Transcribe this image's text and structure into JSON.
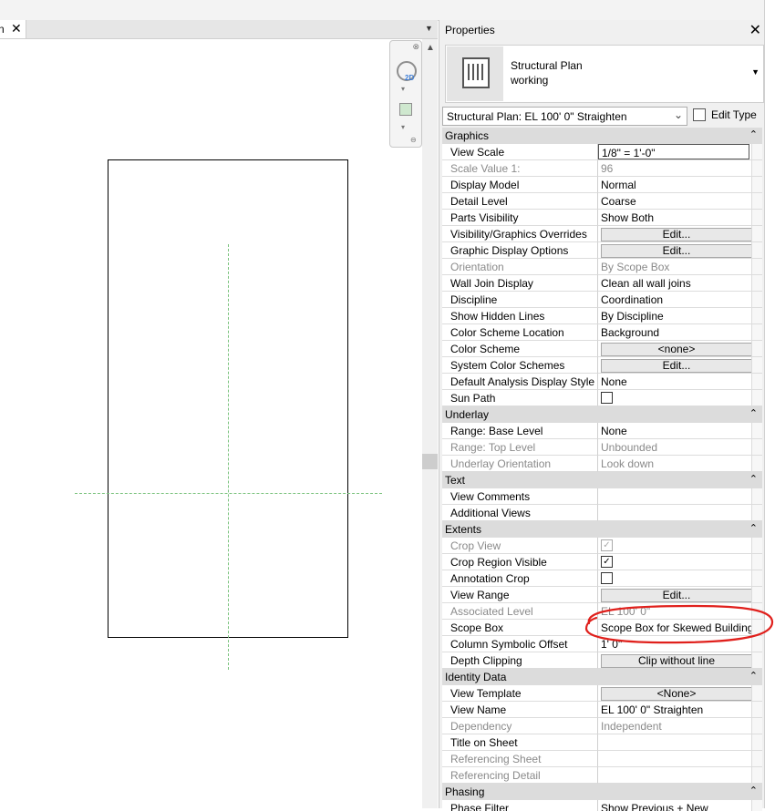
{
  "view_tab": {
    "title_partial": "n",
    "close_glyph": "✕"
  },
  "canvas": {
    "up_arrow": "▲"
  },
  "properties": {
    "title": "Properties",
    "close_glyph": "✕",
    "type_name_line1": "Structural Plan",
    "type_name_line2": "working",
    "view_selector_value": "Structural Plan: EL 100'  0\" Straighten",
    "edit_type_label": "Edit Type",
    "rows": [
      {
        "kind": "cat",
        "label": "Graphics"
      },
      {
        "kind": "prop",
        "label": "View Scale",
        "value": "1/8\" = 1'-0\"",
        "editbox": true
      },
      {
        "kind": "prop",
        "label": "Scale Value    1:",
        "value": "96",
        "disabled": true
      },
      {
        "kind": "prop",
        "label": "Display Model",
        "value": "Normal"
      },
      {
        "kind": "prop",
        "label": "Detail Level",
        "value": "Coarse"
      },
      {
        "kind": "prop",
        "label": "Parts Visibility",
        "value": "Show Both"
      },
      {
        "kind": "prop",
        "label": "Visibility/Graphics Overrides",
        "value": "Edit...",
        "button": true
      },
      {
        "kind": "prop",
        "label": "Graphic Display Options",
        "value": "Edit...",
        "button": true
      },
      {
        "kind": "prop",
        "label": "Orientation",
        "value": "By Scope Box",
        "disabled": true
      },
      {
        "kind": "prop",
        "label": "Wall Join Display",
        "value": "Clean all wall joins"
      },
      {
        "kind": "prop",
        "label": "Discipline",
        "value": "Coordination"
      },
      {
        "kind": "prop",
        "label": "Show Hidden Lines",
        "value": "By Discipline"
      },
      {
        "kind": "prop",
        "label": "Color Scheme Location",
        "value": "Background"
      },
      {
        "kind": "prop",
        "label": "Color Scheme",
        "value": "<none>",
        "button": true
      },
      {
        "kind": "prop",
        "label": "System Color Schemes",
        "value": "Edit...",
        "button": true
      },
      {
        "kind": "prop",
        "label": "Default Analysis Display Style",
        "value": "None"
      },
      {
        "kind": "prop",
        "label": "Sun Path",
        "checkbox": true,
        "checked": false
      },
      {
        "kind": "cat",
        "label": "Underlay"
      },
      {
        "kind": "prop",
        "label": "Range: Base Level",
        "value": "None"
      },
      {
        "kind": "prop",
        "label": "Range: Top Level",
        "value": "Unbounded",
        "disabled": true
      },
      {
        "kind": "prop",
        "label": "Underlay Orientation",
        "value": "Look down",
        "disabled": true
      },
      {
        "kind": "cat",
        "label": "Text"
      },
      {
        "kind": "prop",
        "label": "View Comments",
        "value": ""
      },
      {
        "kind": "prop",
        "label": "Additional Views",
        "value": ""
      },
      {
        "kind": "cat",
        "label": "Extents"
      },
      {
        "kind": "prop",
        "label": "Crop View",
        "checkbox": true,
        "checked": true,
        "disabled": true
      },
      {
        "kind": "prop",
        "label": "Crop Region Visible",
        "checkbox": true,
        "checked": true
      },
      {
        "kind": "prop",
        "label": "Annotation Crop",
        "checkbox": true,
        "checked": false
      },
      {
        "kind": "prop",
        "label": "View Range",
        "value": "Edit...",
        "button": true
      },
      {
        "kind": "prop",
        "label": "Associated Level",
        "value": "EL 100'  0\"",
        "disabled": true
      },
      {
        "kind": "prop",
        "label": "Scope Box",
        "value": "Scope Box for Skewed Building"
      },
      {
        "kind": "prop",
        "label": "Column Symbolic Offset",
        "value": "1'  0\""
      },
      {
        "kind": "prop",
        "label": "Depth Clipping",
        "value": "Clip without line",
        "button": true
      },
      {
        "kind": "cat",
        "label": "Identity Data"
      },
      {
        "kind": "prop",
        "label": "View Template",
        "value": "<None>",
        "button": true
      },
      {
        "kind": "prop",
        "label": "View Name",
        "value": "EL 100'  0\" Straighten"
      },
      {
        "kind": "prop",
        "label": "Dependency",
        "value": "Independent",
        "disabled": true
      },
      {
        "kind": "prop",
        "label": "Title on Sheet",
        "value": ""
      },
      {
        "kind": "prop",
        "label": "Referencing Sheet",
        "value": "",
        "disabled": true
      },
      {
        "kind": "prop",
        "label": "Referencing Detail",
        "value": "",
        "disabled": true
      },
      {
        "kind": "cat",
        "label": "Phasing"
      },
      {
        "kind": "prop",
        "label": "Phase Filter",
        "value": "Show Previous + New"
      }
    ]
  },
  "icons": {
    "collapse": "chevron-double-up-icon",
    "dropdown": "chevron-down-icon",
    "close": "close-icon",
    "steering_wheel": "steering-wheel-icon",
    "zoom": "zoom-region-icon"
  },
  "colors": {
    "annotation_red": "#e0201c",
    "ref_plane_green": "#79c27c"
  }
}
